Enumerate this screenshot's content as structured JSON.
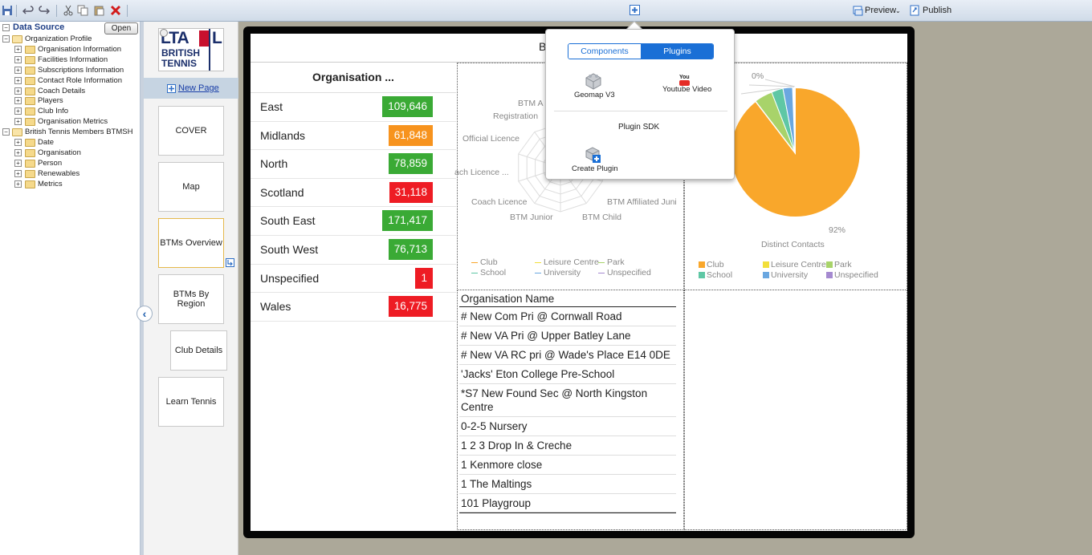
{
  "toolbar": {
    "preview_label": "Preview",
    "publish_label": "Publish"
  },
  "datasource": {
    "title": "Data Source",
    "open_label": "Open",
    "tree": [
      {
        "label": "Organization Profile",
        "level": 0,
        "expanded": true
      },
      {
        "label": "Organisation Information",
        "level": 1
      },
      {
        "label": "Facilities Information",
        "level": 1
      },
      {
        "label": "Subscriptions Information",
        "level": 1
      },
      {
        "label": "Contact Role Information",
        "level": 1
      },
      {
        "label": "Coach Details",
        "level": 1
      },
      {
        "label": "Players",
        "level": 1
      },
      {
        "label": "Club Info",
        "level": 1
      },
      {
        "label": "Organisation Metrics",
        "level": 1
      },
      {
        "label": "British Tennis Members BTMSH",
        "level": 0,
        "expanded": true
      },
      {
        "label": "Date",
        "level": 1
      },
      {
        "label": "Organisation",
        "level": 1
      },
      {
        "label": "Person",
        "level": 1
      },
      {
        "label": "Renewables",
        "level": 1
      },
      {
        "label": "Metrics",
        "level": 1
      }
    ]
  },
  "pages": {
    "logo_top": "LTA",
    "logo_line1": "BRITISH",
    "logo_line2": "TENNIS",
    "new_page_label": "New Page",
    "items": [
      "COVER",
      "Map",
      "BTMs Overview",
      "BTMs By Region",
      "Club Details",
      "Learn Tennis"
    ]
  },
  "canvas": {
    "title_fragment": "B",
    "region_table": {
      "title": "Organisation ...",
      "rows": [
        {
          "name": "East",
          "value": "109,646",
          "color": "#3aaa35"
        },
        {
          "name": "Midlands",
          "value": "61,848",
          "color": "#f7931e"
        },
        {
          "name": "North",
          "value": "78,859",
          "color": "#3aaa35"
        },
        {
          "name": "Scotland",
          "value": "31,118",
          "color": "#ee1c24"
        },
        {
          "name": "South East",
          "value": "171,417",
          "color": "#3aaa35"
        },
        {
          "name": "South West",
          "value": "76,713",
          "color": "#3aaa35"
        },
        {
          "name": "Unspecified",
          "value": "1",
          "color": "#ee1c24"
        },
        {
          "name": "Wales",
          "value": "16,775",
          "color": "#ee1c24"
        }
      ]
    },
    "radar": {
      "labels": [
        "BTM A",
        "Registration",
        "Official Licence",
        "ach Licence ...",
        "Coach Licence",
        "BTM Junior",
        "BTM Child",
        "BTM Affiliated Juni"
      ],
      "legend": [
        "Club",
        "Leisure Centre",
        "Park",
        "School",
        "University",
        "Unspecified"
      ]
    },
    "pie": {
      "label_top": "0%",
      "label_bottom": "92%",
      "title": "Distinct Contacts",
      "legend": [
        "Club",
        "Leisure Centre",
        "Park",
        "School",
        "University",
        "Unspecified"
      ]
    },
    "org_list": {
      "header": "Organisation Name",
      "rows": [
        "# New Com Pri @ Cornwall Road",
        "# New VA Pri @ Upper Batley Lane",
        "# New VA RC pri @ Wade's Place E14 0DE",
        "'Jacks' Eton College Pre-School",
        "*S7 New Found Sec @ North Kingston Centre",
        "0-2-5 Nursery",
        "1 2 3 Drop In & Creche",
        "1 Kenmore close",
        "1 The Maltings",
        "101 Playgroup"
      ]
    }
  },
  "popup": {
    "tab_components": "Components",
    "tab_plugins": "Plugins",
    "plugin_geomap": "Geomap V3",
    "plugin_youtube": "Youtube Video",
    "youtube_logo_text": "You",
    "sdk_heading": "Plugin SDK",
    "create_plugin": "Create Plugin"
  },
  "colors": {
    "club": "#f9a72b",
    "leisure": "#f2df3a",
    "park": "#a8d36a",
    "school": "#5fc7a5",
    "university": "#6aa7e0",
    "unspecified": "#a58ad0"
  }
}
